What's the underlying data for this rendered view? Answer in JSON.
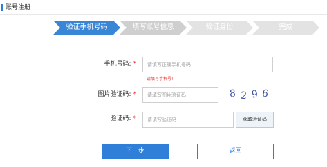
{
  "header": {
    "title": "账号注册"
  },
  "steps": [
    {
      "label": "验证手机号码",
      "color": "#3a86d6",
      "text_color": "#ffffff"
    },
    {
      "label": "填写账号信息",
      "color": "#cfcfcf",
      "text_color": "#ffffff"
    },
    {
      "label": "验证身份",
      "color": "#e3e3e3",
      "text_color": "#ffffff"
    },
    {
      "label": "完成",
      "color": "#e3e3e3",
      "text_color": "#ffffff"
    }
  ],
  "form": {
    "phone": {
      "label": "手机号码:",
      "required": "*",
      "placeholder": "请填写正确手机号码",
      "error": "请填写手机号!"
    },
    "image_code": {
      "label": "图片验证码:",
      "required": "*",
      "placeholder": "请填写图片验证码",
      "captcha": [
        "8",
        "2",
        "9",
        "6"
      ]
    },
    "sms_code": {
      "label": "验证码:",
      "required": "*",
      "placeholder": "请填写验证码",
      "get_code_label": "获取验证码"
    }
  },
  "actions": {
    "next_label": "下一步",
    "back_label": "返回"
  },
  "colors": {
    "primary": "#2f7ed8",
    "error": "#e33333"
  }
}
